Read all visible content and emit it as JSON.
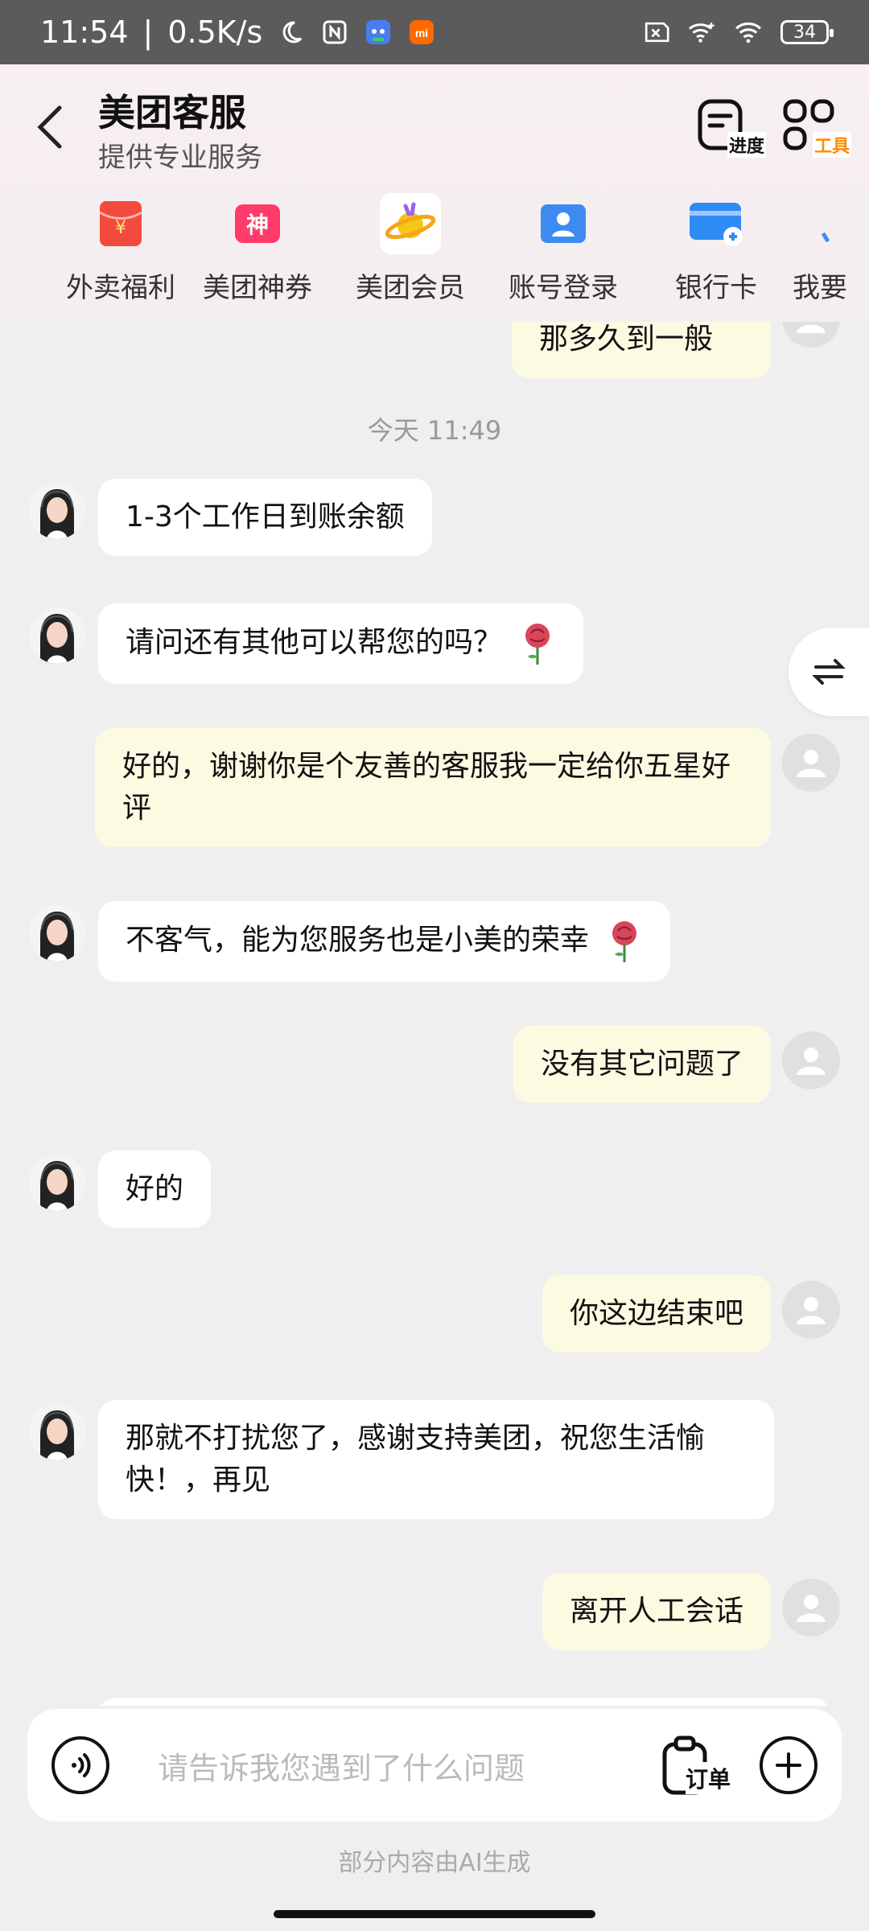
{
  "status_bar": {
    "time": "11:54",
    "speed": "0.5K/s",
    "battery": "34"
  },
  "header": {
    "title": "美团客服",
    "subtitle": "提供专业服务",
    "progress_label": "进度",
    "tools_label": "工具",
    "tools_color": "#ff8a00"
  },
  "quick_items": [
    {
      "label": "外卖福利",
      "icon": "red-envelope-icon",
      "color": "#f24b3d"
    },
    {
      "label": "美团神券",
      "icon": "coupon-icon",
      "color": "#ff3b6b"
    },
    {
      "label": "美团会员",
      "icon": "member-planet-icon",
      "color": "#f5c518"
    },
    {
      "label": "账号登录",
      "icon": "account-icon",
      "color": "#3d8bf2"
    },
    {
      "label": "银行卡",
      "icon": "bank-card-icon",
      "color": "#2f8cf5"
    },
    {
      "label": "我要",
      "icon": "more-icon",
      "color": "#3d8bf2"
    }
  ],
  "chat": {
    "partial_top_message": "那多久到一般",
    "time_separator": "今天 11:49",
    "messages": [
      {
        "from": "bot",
        "text": "1-3个工作日到账余额"
      },
      {
        "from": "bot",
        "text": "请问还有其他可以帮您的吗？",
        "emoji": "rose-icon"
      },
      {
        "from": "me",
        "text": "好的，谢谢你是个友善的客服我一定给你五星好评"
      },
      {
        "from": "bot",
        "text": "不客气，能为您服务也是小美的荣幸",
        "emoji": "rose-icon"
      },
      {
        "from": "me",
        "text": "没有其它问题了"
      },
      {
        "from": "bot",
        "text": "好的"
      },
      {
        "from": "me",
        "text": "你这边结束吧"
      },
      {
        "from": "bot",
        "text": "那就不打扰您了，感谢支持美团，祝您生活愉快！，再见"
      },
      {
        "from": "me",
        "text": "离开人工会话"
      }
    ]
  },
  "input": {
    "placeholder": "请告诉我您遇到了什么问题",
    "order_label": "订单"
  },
  "footer_note": "部分内容由AI生成"
}
